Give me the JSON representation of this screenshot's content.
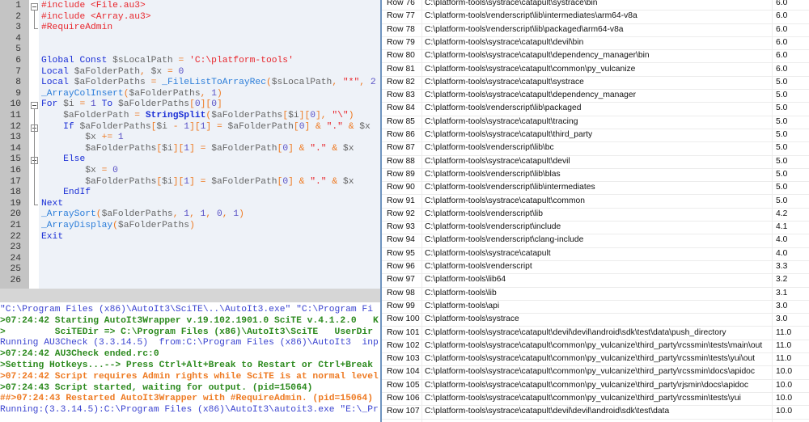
{
  "editor": {
    "lines": [
      {
        "n": "1",
        "tokens": [
          [
            "t-pre",
            "#include <File.au3>"
          ]
        ]
      },
      {
        "n": "2",
        "tokens": [
          [
            "t-pre",
            "#include <Array.au3>"
          ]
        ]
      },
      {
        "n": "3",
        "tokens": [
          [
            "t-pre",
            "#RequireAdmin"
          ]
        ]
      },
      {
        "n": "4",
        "tokens": []
      },
      {
        "n": "5",
        "tokens": []
      },
      {
        "n": "6",
        "tokens": [
          [
            "t-kw",
            "Global Const "
          ],
          [
            "t-var",
            "$sLocalPath "
          ],
          [
            "t-op",
            "= "
          ],
          [
            "t-str",
            "'C:\\platform-tools'"
          ]
        ]
      },
      {
        "n": "7",
        "tokens": [
          [
            "t-kw",
            "Local "
          ],
          [
            "t-var",
            "$aFolderPath"
          ],
          [
            "t-op",
            ", "
          ],
          [
            "t-var",
            "$x "
          ],
          [
            "t-op",
            "= "
          ],
          [
            "t-num",
            "0"
          ]
        ]
      },
      {
        "n": "8",
        "tokens": [
          [
            "t-kw",
            "Local "
          ],
          [
            "t-var",
            "$aFolderPaths "
          ],
          [
            "t-op",
            "= "
          ],
          [
            "t-fn",
            "_FileListToArrayRec"
          ],
          [
            "t-op",
            "("
          ],
          [
            "t-var",
            "$sLocalPath"
          ],
          [
            "t-op",
            ", "
          ],
          [
            "t-str",
            "\"*\""
          ],
          [
            "t-op",
            ", "
          ],
          [
            "t-num",
            "2"
          ]
        ]
      },
      {
        "n": "9",
        "tokens": [
          [
            "t-fn",
            "_ArrayColInsert"
          ],
          [
            "t-op",
            "("
          ],
          [
            "t-var",
            "$aFolderPaths"
          ],
          [
            "t-op",
            ", "
          ],
          [
            "t-num",
            "1"
          ],
          [
            "t-op",
            ")"
          ]
        ]
      },
      {
        "n": "10",
        "tokens": [
          [
            "t-kw",
            "For "
          ],
          [
            "t-var",
            "$i "
          ],
          [
            "t-op",
            "= "
          ],
          [
            "t-num",
            "1 "
          ],
          [
            "t-kw",
            "To "
          ],
          [
            "t-var",
            "$aFolderPaths"
          ],
          [
            "t-op",
            "["
          ],
          [
            "t-num",
            "0"
          ],
          [
            "t-op",
            "]["
          ],
          [
            "t-num",
            "0"
          ],
          [
            "t-op",
            "]"
          ]
        ]
      },
      {
        "n": "11",
        "tokens": [
          [
            "t-def",
            "    "
          ],
          [
            "t-var",
            "$aFolderPath "
          ],
          [
            "t-op",
            "= "
          ],
          [
            "t-bfn",
            "StringSplit"
          ],
          [
            "t-op",
            "("
          ],
          [
            "t-var",
            "$aFolderPaths"
          ],
          [
            "t-op",
            "["
          ],
          [
            "t-var",
            "$i"
          ],
          [
            "t-op",
            "]["
          ],
          [
            "t-num",
            "0"
          ],
          [
            "t-op",
            "], "
          ],
          [
            "t-str",
            "\"\\\""
          ],
          [
            "t-op",
            ")"
          ]
        ]
      },
      {
        "n": "12",
        "tokens": [
          [
            "t-def",
            "    "
          ],
          [
            "t-kw",
            "If "
          ],
          [
            "t-var",
            "$aFolderPaths"
          ],
          [
            "t-op",
            "["
          ],
          [
            "t-var",
            "$i "
          ],
          [
            "t-op",
            "- "
          ],
          [
            "t-num",
            "1"
          ],
          [
            "t-op",
            "]["
          ],
          [
            "t-num",
            "1"
          ],
          [
            "t-op",
            "] = "
          ],
          [
            "t-var",
            "$aFolderPath"
          ],
          [
            "t-op",
            "["
          ],
          [
            "t-num",
            "0"
          ],
          [
            "t-op",
            "] & "
          ],
          [
            "t-str",
            "\".\" "
          ],
          [
            "t-op",
            "& "
          ],
          [
            "t-var",
            "$x"
          ]
        ]
      },
      {
        "n": "13",
        "tokens": [
          [
            "t-def",
            "        "
          ],
          [
            "t-var",
            "$x "
          ],
          [
            "t-op",
            "+= "
          ],
          [
            "t-num",
            "1"
          ]
        ]
      },
      {
        "n": "14",
        "tokens": [
          [
            "t-def",
            "        "
          ],
          [
            "t-var",
            "$aFolderPaths"
          ],
          [
            "t-op",
            "["
          ],
          [
            "t-var",
            "$i"
          ],
          [
            "t-op",
            "]["
          ],
          [
            "t-num",
            "1"
          ],
          [
            "t-op",
            "] = "
          ],
          [
            "t-var",
            "$aFolderPath"
          ],
          [
            "t-op",
            "["
          ],
          [
            "t-num",
            "0"
          ],
          [
            "t-op",
            "] & "
          ],
          [
            "t-str",
            "\".\" "
          ],
          [
            "t-op",
            "& "
          ],
          [
            "t-var",
            "$x"
          ]
        ]
      },
      {
        "n": "15",
        "tokens": [
          [
            "t-def",
            "    "
          ],
          [
            "t-kw",
            "Else"
          ]
        ]
      },
      {
        "n": "16",
        "tokens": [
          [
            "t-def",
            "        "
          ],
          [
            "t-var",
            "$x "
          ],
          [
            "t-op",
            "= "
          ],
          [
            "t-num",
            "0"
          ]
        ]
      },
      {
        "n": "17",
        "tokens": [
          [
            "t-def",
            "        "
          ],
          [
            "t-var",
            "$aFolderPaths"
          ],
          [
            "t-op",
            "["
          ],
          [
            "t-var",
            "$i"
          ],
          [
            "t-op",
            "]["
          ],
          [
            "t-num",
            "1"
          ],
          [
            "t-op",
            "] = "
          ],
          [
            "t-var",
            "$aFolderPath"
          ],
          [
            "t-op",
            "["
          ],
          [
            "t-num",
            "0"
          ],
          [
            "t-op",
            "] & "
          ],
          [
            "t-str",
            "\".\" "
          ],
          [
            "t-op",
            "& "
          ],
          [
            "t-var",
            "$x"
          ]
        ]
      },
      {
        "n": "18",
        "tokens": [
          [
            "t-def",
            "    "
          ],
          [
            "t-kw",
            "EndIf"
          ]
        ]
      },
      {
        "n": "19",
        "tokens": [
          [
            "t-kw",
            "Next"
          ]
        ]
      },
      {
        "n": "20",
        "tokens": [
          [
            "t-fn",
            "_ArraySort"
          ],
          [
            "t-op",
            "("
          ],
          [
            "t-var",
            "$aFolderPaths"
          ],
          [
            "t-op",
            ", "
          ],
          [
            "t-num",
            "1"
          ],
          [
            "t-op",
            ", "
          ],
          [
            "t-num",
            "1"
          ],
          [
            "t-op",
            ", "
          ],
          [
            "t-num",
            "0"
          ],
          [
            "t-op",
            ", "
          ],
          [
            "t-num",
            "1"
          ],
          [
            "t-op",
            ")"
          ]
        ]
      },
      {
        "n": "21",
        "tokens": [
          [
            "t-fn",
            "_ArrayDisplay"
          ],
          [
            "t-op",
            "("
          ],
          [
            "t-var",
            "$aFolderPaths"
          ],
          [
            "t-op",
            ")"
          ]
        ]
      },
      {
        "n": "22",
        "tokens": [
          [
            "t-kw",
            "Exit"
          ]
        ]
      },
      {
        "n": "23",
        "tokens": []
      },
      {
        "n": "24",
        "tokens": []
      },
      {
        "n": "25",
        "tokens": []
      },
      {
        "n": "26",
        "tokens": []
      }
    ]
  },
  "output": {
    "lines": [
      {
        "cls": "o-blue",
        "text": "\"C:\\Program Files (x86)\\AutoIt3\\SciTE\\..\\AutoIt3.exe\" \"C:\\Program Fi"
      },
      {
        "cls": "o-green",
        "text": ">07:24:42 Starting AutoIt3Wrapper v.19.102.1901.0 SciTE v.4.1.2.0   K"
      },
      {
        "cls": "o-green",
        "text": ">         SciTEDir => C:\\Program Files (x86)\\AutoIt3\\SciTE   UserDir"
      },
      {
        "cls": "o-blue",
        "text": "Running AU3Check (3.3.14.5)  from:C:\\Program Files (x86)\\AutoIt3  inp"
      },
      {
        "cls": "o-green",
        "text": ">07:24:42 AU3Check ended.rc:0"
      },
      {
        "cls": "o-green",
        "text": ">Setting Hotkeys...--> Press Ctrl+Alt+Break to Restart or Ctrl+Break"
      },
      {
        "cls": "o-orange",
        "text": ">07:24:42 Script requires Admin rights while SciTE is at normal level"
      },
      {
        "cls": "o-green",
        "text": ">07:24:43 Script started, waiting for output. (pid=15064)"
      },
      {
        "cls": "o-orange",
        "text": "##>07:24:43 Restarted AutoIt3Wrapper with #RequireAdmin. (pid=15064)"
      },
      {
        "cls": "o-blue",
        "text": "Running:(3.3.14.5):C:\\Program Files (x86)\\AutoIt3\\autoit3.exe \"E:\\_Pr"
      }
    ]
  },
  "array_display": {
    "rows": [
      {
        "row": "Row 76",
        "path": "C:\\platform-tools\\systrace\\catapult\\systrace\\bin",
        "value": "6.0"
      },
      {
        "row": "Row 77",
        "path": "C:\\platform-tools\\renderscript\\lib\\intermediates\\arm64-v8a",
        "value": "6.0"
      },
      {
        "row": "Row 78",
        "path": "C:\\platform-tools\\renderscript\\lib\\packaged\\arm64-v8a",
        "value": "6.0"
      },
      {
        "row": "Row 79",
        "path": "C:\\platform-tools\\systrace\\catapult\\devil\\bin",
        "value": "6.0"
      },
      {
        "row": "Row 80",
        "path": "C:\\platform-tools\\systrace\\catapult\\dependency_manager\\bin",
        "value": "6.0"
      },
      {
        "row": "Row 81",
        "path": "C:\\platform-tools\\systrace\\catapult\\common\\py_vulcanize",
        "value": "6.0"
      },
      {
        "row": "Row 82",
        "path": "C:\\platform-tools\\systrace\\catapult\\systrace",
        "value": "5.0"
      },
      {
        "row": "Row 83",
        "path": "C:\\platform-tools\\systrace\\catapult\\dependency_manager",
        "value": "5.0"
      },
      {
        "row": "Row 84",
        "path": "C:\\platform-tools\\renderscript\\lib\\packaged",
        "value": "5.0"
      },
      {
        "row": "Row 85",
        "path": "C:\\platform-tools\\systrace\\catapult\\tracing",
        "value": "5.0"
      },
      {
        "row": "Row 86",
        "path": "C:\\platform-tools\\systrace\\catapult\\third_party",
        "value": "5.0"
      },
      {
        "row": "Row 87",
        "path": "C:\\platform-tools\\renderscript\\lib\\bc",
        "value": "5.0"
      },
      {
        "row": "Row 88",
        "path": "C:\\platform-tools\\systrace\\catapult\\devil",
        "value": "5.0"
      },
      {
        "row": "Row 89",
        "path": "C:\\platform-tools\\renderscript\\lib\\blas",
        "value": "5.0"
      },
      {
        "row": "Row 90",
        "path": "C:\\platform-tools\\renderscript\\lib\\intermediates",
        "value": "5.0"
      },
      {
        "row": "Row 91",
        "path": "C:\\platform-tools\\systrace\\catapult\\common",
        "value": "5.0"
      },
      {
        "row": "Row 92",
        "path": "C:\\platform-tools\\renderscript\\lib",
        "value": "4.2"
      },
      {
        "row": "Row 93",
        "path": "C:\\platform-tools\\renderscript\\include",
        "value": "4.1"
      },
      {
        "row": "Row 94",
        "path": "C:\\platform-tools\\renderscript\\clang-include",
        "value": "4.0"
      },
      {
        "row": "Row 95",
        "path": "C:\\platform-tools\\systrace\\catapult",
        "value": "4.0"
      },
      {
        "row": "Row 96",
        "path": "C:\\platform-tools\\renderscript",
        "value": "3.3"
      },
      {
        "row": "Row 97",
        "path": "C:\\platform-tools\\lib64",
        "value": "3.2"
      },
      {
        "row": "Row 98",
        "path": "C:\\platform-tools\\lib",
        "value": "3.1"
      },
      {
        "row": "Row 99",
        "path": "C:\\platform-tools\\api",
        "value": "3.0"
      },
      {
        "row": "Row 100",
        "path": "C:\\platform-tools\\systrace",
        "value": "3.0"
      },
      {
        "row": "Row 101",
        "path": "C:\\platform-tools\\systrace\\catapult\\devil\\devil\\android\\sdk\\test\\data\\push_directory",
        "value": "11.0"
      },
      {
        "row": "Row 102",
        "path": "C:\\platform-tools\\systrace\\catapult\\common\\py_vulcanize\\third_party\\rcssmin\\tests\\main\\out",
        "value": "11.0"
      },
      {
        "row": "Row 103",
        "path": "C:\\platform-tools\\systrace\\catapult\\common\\py_vulcanize\\third_party\\rcssmin\\tests\\yui\\out",
        "value": "11.0"
      },
      {
        "row": "Row 104",
        "path": "C:\\platform-tools\\systrace\\catapult\\common\\py_vulcanize\\third_party\\rcssmin\\docs\\apidoc",
        "value": "10.0"
      },
      {
        "row": "Row 105",
        "path": "C:\\platform-tools\\systrace\\catapult\\common\\py_vulcanize\\third_party\\rjsmin\\docs\\apidoc",
        "value": "10.0"
      },
      {
        "row": "Row 106",
        "path": "C:\\platform-tools\\systrace\\catapult\\common\\py_vulcanize\\third_party\\rcssmin\\tests\\yui",
        "value": "10.0"
      },
      {
        "row": "Row 107",
        "path": "C:\\platform-tools\\systrace\\catapult\\devil\\devil\\android\\sdk\\test\\data",
        "value": "10.0"
      }
    ]
  }
}
